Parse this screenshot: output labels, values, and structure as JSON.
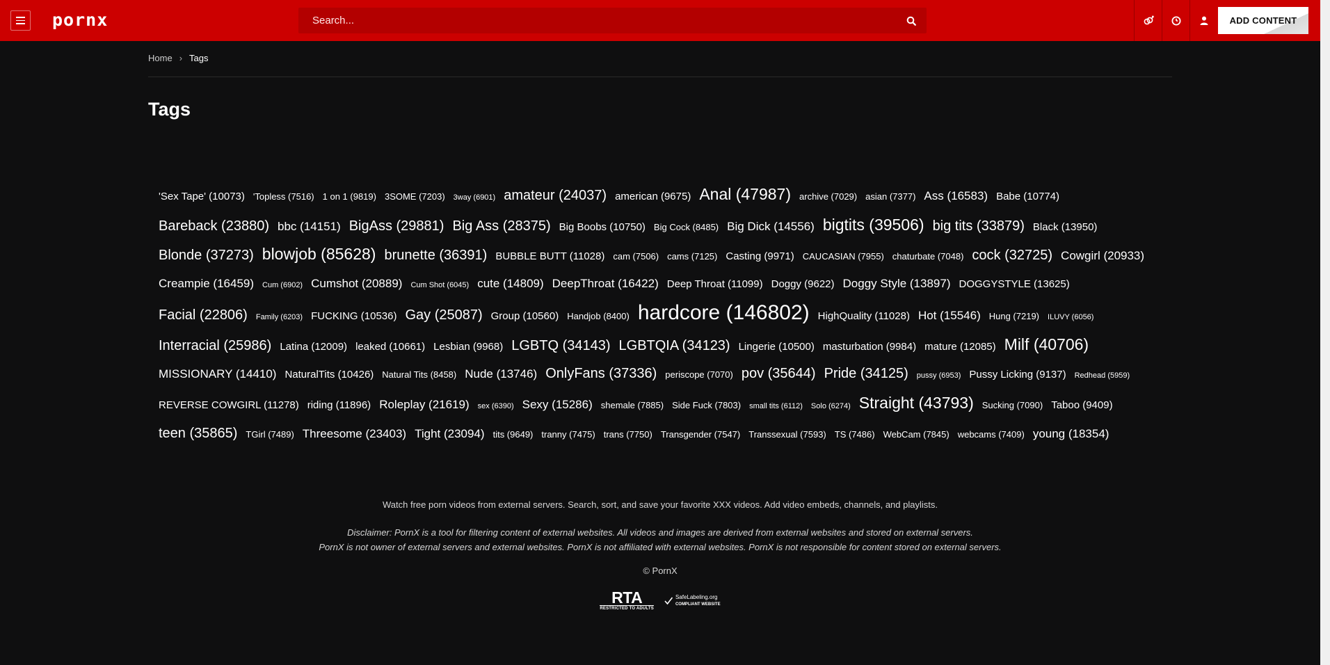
{
  "header": {
    "logo": "pornx",
    "search_placeholder": "Search...",
    "add_content_label": "ADD CONTENT"
  },
  "breadcrumb": {
    "home": "Home",
    "current": "Tags"
  },
  "page_title": "Tags",
  "tags": [
    {
      "label": "'Sex Tape' (10073)",
      "size": 3
    },
    {
      "label": "'Topless (7516)",
      "size": 2
    },
    {
      "label": "1 on 1 (9819)",
      "size": 2
    },
    {
      "label": "3SOME (7203)",
      "size": 2
    },
    {
      "label": "3way (6901)",
      "size": 1
    },
    {
      "label": "amateur (24037)",
      "size": 5
    },
    {
      "label": "american (9675)",
      "size": 3
    },
    {
      "label": "Anal (47987)",
      "size": 6
    },
    {
      "label": "archive (7029)",
      "size": 2
    },
    {
      "label": "asian (7377)",
      "size": 2
    },
    {
      "label": "Ass (16583)",
      "size": 4
    },
    {
      "label": "Babe (10774)",
      "size": 3
    },
    {
      "label": "Bareback (23880)",
      "size": 5
    },
    {
      "label": "bbc (14151)",
      "size": 4
    },
    {
      "label": "BigAss (29881)",
      "size": 5
    },
    {
      "label": "Big Ass (28375)",
      "size": 5
    },
    {
      "label": "Big Boobs (10750)",
      "size": 3
    },
    {
      "label": "Big Cock (8485)",
      "size": 2
    },
    {
      "label": "Big Dick (14556)",
      "size": 4
    },
    {
      "label": "bigtits (39506)",
      "size": 6
    },
    {
      "label": "big tits (33879)",
      "size": 5
    },
    {
      "label": "Black (13950)",
      "size": 3
    },
    {
      "label": "Blonde (37273)",
      "size": 5
    },
    {
      "label": "blowjob (85628)",
      "size": 6
    },
    {
      "label": "brunette (36391)",
      "size": 5
    },
    {
      "label": "BUBBLE BUTT (11028)",
      "size": 3
    },
    {
      "label": "cam (7506)",
      "size": 2
    },
    {
      "label": "cams (7125)",
      "size": 2
    },
    {
      "label": "Casting (9971)",
      "size": 3
    },
    {
      "label": "CAUCASIAN (7955)",
      "size": 2
    },
    {
      "label": "chaturbate (7048)",
      "size": 2
    },
    {
      "label": "cock (32725)",
      "size": 5
    },
    {
      "label": "Cowgirl (20933)",
      "size": 4
    },
    {
      "label": "Creampie (16459)",
      "size": 4
    },
    {
      "label": "Cum (6902)",
      "size": 1
    },
    {
      "label": "Cumshot (20889)",
      "size": 4
    },
    {
      "label": "Cum Shot (6045)",
      "size": 1
    },
    {
      "label": "cute (14809)",
      "size": 4
    },
    {
      "label": "DeepThroat (16422)",
      "size": 4
    },
    {
      "label": "Deep Throat (11099)",
      "size": 3
    },
    {
      "label": "Doggy (9622)",
      "size": 3
    },
    {
      "label": "Doggy Style (13897)",
      "size": 4
    },
    {
      "label": "DOGGYSTYLE (13625)",
      "size": 3
    },
    {
      "label": "Facial (22806)",
      "size": 5
    },
    {
      "label": "Family (6203)",
      "size": 1
    },
    {
      "label": "FUCKING (10536)",
      "size": 3
    },
    {
      "label": "Gay (25087)",
      "size": 5
    },
    {
      "label": "Group (10560)",
      "size": 3
    },
    {
      "label": "Handjob (8400)",
      "size": 2
    },
    {
      "label": "hardcore (146802)",
      "size": 7
    },
    {
      "label": "HighQuality (11028)",
      "size": 3
    },
    {
      "label": "Hot (15546)",
      "size": 4
    },
    {
      "label": "Hung (7219)",
      "size": 2
    },
    {
      "label": "ILUVY (6056)",
      "size": 1
    },
    {
      "label": "Interracial (25986)",
      "size": 5
    },
    {
      "label": "Latina (12009)",
      "size": 3
    },
    {
      "label": "leaked (10661)",
      "size": 3
    },
    {
      "label": "Lesbian (9968)",
      "size": 3
    },
    {
      "label": "LGBTQ (34143)",
      "size": 5
    },
    {
      "label": "LGBTQIA (34123)",
      "size": 5
    },
    {
      "label": "Lingerie (10500)",
      "size": 3
    },
    {
      "label": "masturbation (9984)",
      "size": 3
    },
    {
      "label": "mature (12085)",
      "size": 3
    },
    {
      "label": "Milf (40706)",
      "size": 6
    },
    {
      "label": "MISSIONARY (14410)",
      "size": 4
    },
    {
      "label": "NaturalTits (10426)",
      "size": 3
    },
    {
      "label": "Natural Tits (8458)",
      "size": 2
    },
    {
      "label": "Nude (13746)",
      "size": 4
    },
    {
      "label": "OnlyFans (37336)",
      "size": 5
    },
    {
      "label": "periscope (7070)",
      "size": 2
    },
    {
      "label": "pov (35644)",
      "size": 5
    },
    {
      "label": "Pride (34125)",
      "size": 5
    },
    {
      "label": "pussy (6953)",
      "size": 1
    },
    {
      "label": "Pussy Licking (9137)",
      "size": 3
    },
    {
      "label": "Redhead (5959)",
      "size": 1
    },
    {
      "label": "REVERSE COWGIRL (11278)",
      "size": 3
    },
    {
      "label": "riding (11896)",
      "size": 3
    },
    {
      "label": "Roleplay (21619)",
      "size": 4
    },
    {
      "label": "sex (6390)",
      "size": 1
    },
    {
      "label": "Sexy (15286)",
      "size": 4
    },
    {
      "label": "shemale (7885)",
      "size": 2
    },
    {
      "label": "Side Fuck (7803)",
      "size": 2
    },
    {
      "label": "small tits (6112)",
      "size": 1
    },
    {
      "label": "Solo (6274)",
      "size": 1
    },
    {
      "label": "Straight (43793)",
      "size": 6
    },
    {
      "label": "Sucking (7090)",
      "size": 2
    },
    {
      "label": "Taboo (9409)",
      "size": 3
    },
    {
      "label": "teen (35865)",
      "size": 5
    },
    {
      "label": "TGirl (7489)",
      "size": 2
    },
    {
      "label": "Threesome (23403)",
      "size": 4
    },
    {
      "label": "Tight (23094)",
      "size": 4
    },
    {
      "label": "tits (9649)",
      "size": 2
    },
    {
      "label": "tranny (7475)",
      "size": 2
    },
    {
      "label": "trans (7750)",
      "size": 2
    },
    {
      "label": "Transgender (7547)",
      "size": 2
    },
    {
      "label": "Transsexual (7593)",
      "size": 2
    },
    {
      "label": "TS (7486)",
      "size": 2
    },
    {
      "label": "WebCam (7845)",
      "size": 2
    },
    {
      "label": "webcams (7409)",
      "size": 2
    },
    {
      "label": "young (18354)",
      "size": 4
    }
  ],
  "footer": {
    "tagline": "Watch free porn videos from external servers. Search, sort, and save your favorite XXX videos. Add video embeds, channels, and playlists.",
    "disclaimer_line1": "Disclaimer: PornX is a tool for filtering content of external websites. All videos and images are derived from external websites and stored on external servers.",
    "disclaimer_line2": "PornX is not owner of external servers and external websites. PornX is not affiliated with external websites. PornX is not responsible for content stored on external servers.",
    "copyright": "© PornX",
    "rta_label": "RTA",
    "rta_sub": "RESTRICTED TO ADULTS",
    "safelabel_line1": "SafeLabeling.org",
    "safelabel_line2": "COMPLIANT WEBSITE"
  },
  "colors": {
    "header_bg": "#cc0000",
    "search_bg": "#b30000",
    "page_bg": "#0f0f10"
  }
}
